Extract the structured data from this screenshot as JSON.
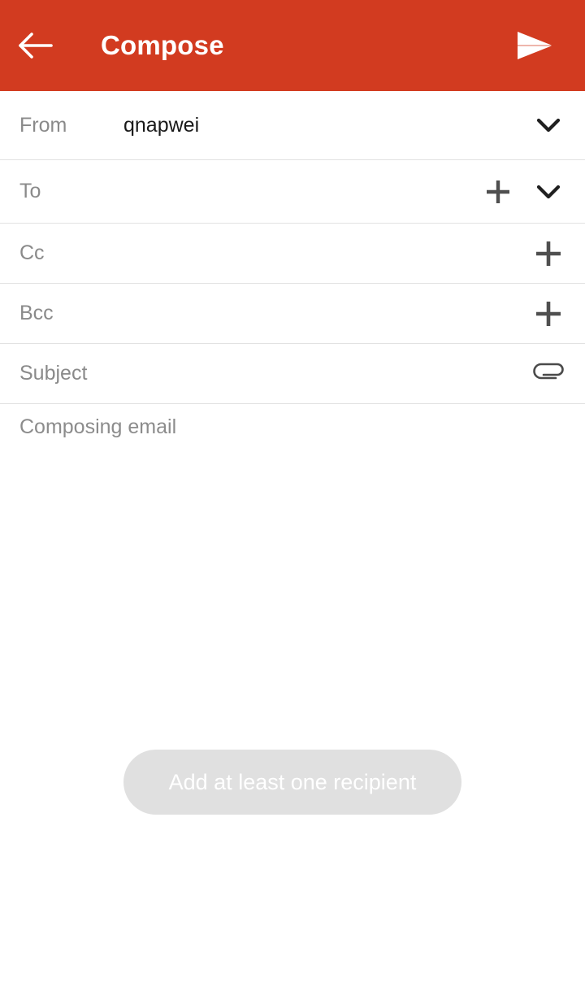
{
  "appbar": {
    "back_icon": "arrow-left-icon",
    "title": "Compose",
    "send_icon": "send-icon",
    "background_color": "#d23b20",
    "text_color": "#ffffff"
  },
  "fields": [
    {
      "key": "from",
      "label": "From",
      "value": "qnapwei",
      "placeholder": "",
      "actions": [
        "chevron-down-icon"
      ]
    },
    {
      "key": "to",
      "label": "To",
      "value": "",
      "placeholder": "To",
      "actions": [
        "plus-icon",
        "chevron-down-icon"
      ]
    },
    {
      "key": "cc",
      "label": "Cc",
      "value": "",
      "placeholder": "Cc",
      "actions": [
        "plus-icon"
      ]
    },
    {
      "key": "bcc",
      "label": "Bcc",
      "value": "",
      "placeholder": "Bcc",
      "actions": [
        "plus-icon"
      ]
    },
    {
      "key": "subject",
      "label": "Subject",
      "value": "",
      "placeholder": "Subject",
      "actions": [
        "attachment-icon"
      ]
    }
  ],
  "body": {
    "placeholder": "Composing email",
    "value": ""
  },
  "toast": {
    "message": "Add at least one recipient",
    "background_color": "#e0e0e0",
    "text_color": "#ffffff"
  },
  "colors": {
    "accent": "#d23b20",
    "label_gray": "#8a8a8a",
    "value_black": "#1a1a1a",
    "divider": "#e2e2e2",
    "icon_gray": "#5a5a5a",
    "page_background": "#ffffff"
  }
}
